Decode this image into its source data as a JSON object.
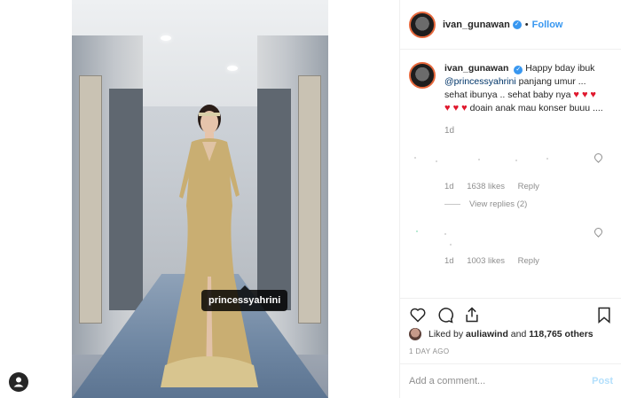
{
  "post": {
    "tag": "princessyahrini",
    "tag_indicator_icon": "user-tag-icon"
  },
  "header": {
    "username": "ivan_gunawan",
    "separator": "•",
    "follow_label": "Follow",
    "verified_icon": "verified-badge-icon"
  },
  "caption": {
    "username": "ivan_gunawan",
    "text_before": "Happy bday ibuk",
    "mention": "@princessyahrini",
    "text_after": "panjang umur ... sehat ibunya .. sehat baby nya",
    "hearts_line1": "♥ ♥",
    "hearts_line2": "♥ ♥ ♥ ♥",
    "text_end": "doain anak mau konser buuu ....",
    "age": "1d"
  },
  "comments": [
    {
      "age": "1d",
      "likes": "1638 likes",
      "reply": "Reply",
      "view_replies": "View replies (2)"
    },
    {
      "age": "1d",
      "likes": "1003 likes",
      "reply": "Reply"
    }
  ],
  "actions": {
    "like_icon": "heart-icon",
    "comment_icon": "comment-icon",
    "share_icon": "share-icon",
    "save_icon": "bookmark-icon"
  },
  "likes": {
    "prefix": "Liked by",
    "user": "auliawind",
    "middle": "and",
    "others": "118,765 others"
  },
  "timestamp": "1 DAY AGO",
  "add_comment": {
    "placeholder": "Add a comment...",
    "post_label": "Post"
  },
  "colors": {
    "link": "#3897f0",
    "text": "#262626",
    "muted": "#8e8e8e",
    "heart": "#e0182d",
    "post_disabled": "#b2dffc"
  }
}
